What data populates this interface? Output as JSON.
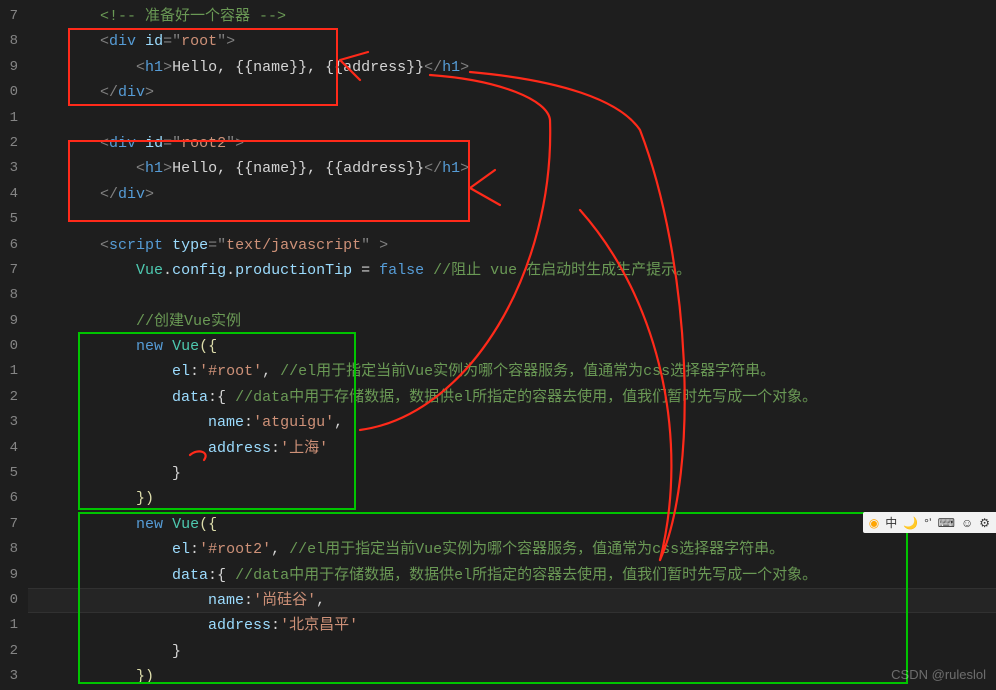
{
  "gutter": [
    "7",
    "8",
    "9",
    "0",
    "1",
    "2",
    "3",
    "4",
    "5",
    "6",
    "7",
    "8",
    "9",
    "0",
    "1",
    "2",
    "3",
    "4",
    "5",
    "6",
    "7",
    "8",
    "9",
    "0",
    "1",
    "2",
    "3"
  ],
  "code": {
    "l17": {
      "comment_prefix": "<!-- ",
      "comment_text": "准备好一个容器",
      "comment_suffix": " -->"
    },
    "l18": {
      "open": "<",
      "tag": "div",
      "sp": " ",
      "attr": "id",
      "eq": "=",
      "q": "\"",
      "val": "root",
      "close": ">"
    },
    "l19": {
      "o1": "<",
      "h1": "h1",
      "c1": ">",
      "txt": "Hello, {{name}}, {{address}}",
      "o2": "</",
      "c2": ">"
    },
    "l20": {
      "open": "</",
      "tag": "div",
      "close": ">"
    },
    "l22": {
      "open": "<",
      "tag": "div",
      "sp": " ",
      "attr": "id",
      "eq": "=",
      "q": "\"",
      "val": "root2",
      "close": ">"
    },
    "l23": {
      "o1": "<",
      "h1": "h1",
      "c1": ">",
      "txt": "Hello, {{name}}, {{address}}",
      "o2": "</",
      "c2": ">"
    },
    "l24": {
      "open": "</",
      "tag": "div",
      "close": ">"
    },
    "l26": {
      "open": "<",
      "tag": "script",
      "sp": " ",
      "attr": "type",
      "eq": "=",
      "q": "\"",
      "val": "text/javascript",
      "close": " >"
    },
    "l27": {
      "obj": "Vue",
      "dot1": ".",
      "p1": "config",
      "dot2": ".",
      "p2": "productionTip",
      "eq": " = ",
      "val": "false",
      "cm": " //阻止 vue 在启动时生成生产提示。"
    },
    "l29": {
      "cm": "//创建Vue实例"
    },
    "l30": {
      "kw": "new",
      "sp": " ",
      "cls": "Vue",
      "open": "({"
    },
    "l31": {
      "k": "el",
      "colon": ":",
      "v": "'#root'",
      "comma": ", ",
      "cm": "//el用于指定当前Vue实例为哪个容器服务，值通常为css选择器字符串。"
    },
    "l32": {
      "k": "data",
      "colon": ":{",
      "sp": " ",
      "cm": "//data中用于存储数据，数据供el所指定的容器去使用，值我们暂时先写成一个对象。"
    },
    "l33": {
      "k": "name",
      "colon": ":",
      "v": "'atguigu'",
      "comma": ","
    },
    "l34": {
      "k": "address",
      "colon": ":",
      "v": "'上海'"
    },
    "l35": {
      "brace": "}"
    },
    "l36": {
      "close": "})"
    },
    "l37": {
      "kw": "new",
      "sp": " ",
      "cls": "Vue",
      "open": "({"
    },
    "l38": {
      "k": "el",
      "colon": ":",
      "v": "'#root2'",
      "comma": ", ",
      "cm": "//el用于指定当前Vue实例为哪个容器服务，值通常为css选择器字符串。"
    },
    "l39": {
      "k": "data",
      "colon": ":{",
      "sp": " ",
      "cm": "//data中用于存储数据，数据供el所指定的容器去使用，值我们暂时先写成一个对象。"
    },
    "l40": {
      "k": "name",
      "colon": ":",
      "v": "'尚硅谷'",
      "comma": ","
    },
    "l41": {
      "k": "address",
      "colon": ":",
      "v": "'北京昌平'"
    },
    "l42": {
      "brace": "}"
    },
    "l43": {
      "close": "})"
    }
  },
  "tray": {
    "a": "中",
    "b": "🌙",
    "c": "°ʼ",
    "d": "⌨",
    "e": "☺",
    "f": "⚙"
  },
  "watermark": "CSDN @ruleslol",
  "icon_circle": "◉"
}
